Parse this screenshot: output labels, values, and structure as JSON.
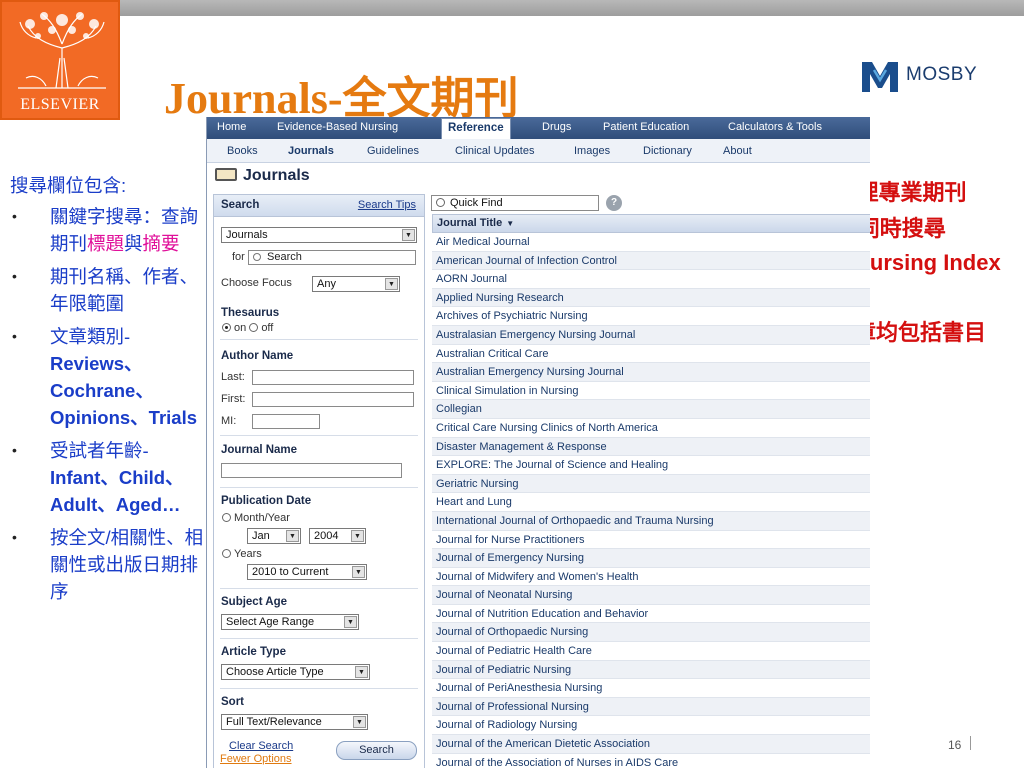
{
  "slide": {
    "title": "Journals-全文期刊",
    "page_number": "16",
    "logo_left": "ELSEVIER",
    "logo_right": "MOSBY"
  },
  "left_notes": {
    "lead": "搜尋欄位包含:",
    "items": [
      {
        "plain": "關鍵字搜尋：查詢期刊",
        "pink": "標題",
        "plain2": "與",
        "pink2": "摘要"
      },
      {
        "plain": "期刊名稱、作者、年限範圍"
      },
      {
        "plain": "文章類別-",
        "bold": "Reviews、Cochrane、Opinions、Trials"
      },
      {
        "plain": "受試者年齡-",
        "bold": "Infant、Child、Adult、Aged…"
      },
      {
        "plain": "按全文/相關性、相關性或出版日期排序"
      }
    ]
  },
  "right_notes": {
    "items": [
      "40本全文護理專業期刊",
      "Journals可同時搜尋 Medline & Nursing Index資料庫",
      "每篇全文文章均包括書目資料及目錄"
    ]
  },
  "app": {
    "nav_primary": [
      "Home",
      "Evidence-Based Nursing",
      "Reference",
      "Drugs",
      "Patient Education",
      "Calculators & Tools"
    ],
    "nav_primary_active": "Reference",
    "nav_secondary": [
      "Books",
      "Journals",
      "Guidelines",
      "Clinical Updates",
      "Images",
      "Dictionary",
      "About"
    ],
    "nav_secondary_active": "Journals",
    "page_heading": "Journals",
    "search_panel": {
      "title": "Search",
      "tips_link": "Search Tips",
      "scope_select": "Journals",
      "for_label": "for",
      "search_placeholder": "Search",
      "focus_label": "Choose Focus",
      "focus_value": "Any",
      "thesaurus_label": "Thesaurus",
      "thesaurus_on": "on",
      "thesaurus_off": "off",
      "author_heading": "Author Name",
      "last_label": "Last:",
      "first_label": "First:",
      "mi_label": "MI:",
      "journal_name_heading": "Journal Name",
      "pubdate_heading": "Publication Date",
      "month_year_label": "Month/Year",
      "month_value": "Jan",
      "year_value": "2004",
      "years_label": "Years",
      "years_value": "2010 to Current",
      "subject_age_heading": "Subject Age",
      "subject_age_value": "Select Age Range",
      "article_type_heading": "Article Type",
      "article_type_value": "Choose Article Type",
      "sort_heading": "Sort",
      "sort_value": "Full Text/Relevance",
      "clear_link": "Clear Search",
      "fewer_link": "Fewer Options",
      "search_button": "Search"
    },
    "quick_find_placeholder": "Quick Find",
    "help_icon": "?",
    "journal_column_header": "Journal Title",
    "journals": [
      "Air Medical Journal",
      "American Journal of Infection Control",
      "AORN Journal",
      "Applied Nursing Research",
      "Archives of Psychiatric Nursing",
      "Australasian Emergency Nursing Journal",
      "Australian Critical Care",
      "Australian Emergency Nursing Journal",
      "Clinical Simulation in Nursing",
      "Collegian",
      "Critical Care Nursing Clinics of North America",
      "Disaster Management & Response",
      "EXPLORE: The Journal of Science and Healing",
      "Geriatric Nursing",
      "Heart and Lung",
      "International Journal of Orthopaedic and Trauma Nursing",
      "Journal for Nurse Practitioners",
      "Journal of Emergency Nursing",
      "Journal of Midwifery and Women's Health",
      "Journal of Neonatal Nursing",
      "Journal of Nutrition Education and Behavior",
      "Journal of Orthopaedic Nursing",
      "Journal of Pediatric Health Care",
      "Journal of Pediatric Nursing",
      "Journal of PeriAnesthesia Nursing",
      "Journal of Professional Nursing",
      "Journal of Radiology Nursing",
      "Journal of the American Dietetic Association",
      "Journal of the Association of Nurses in AIDS Care"
    ]
  }
}
